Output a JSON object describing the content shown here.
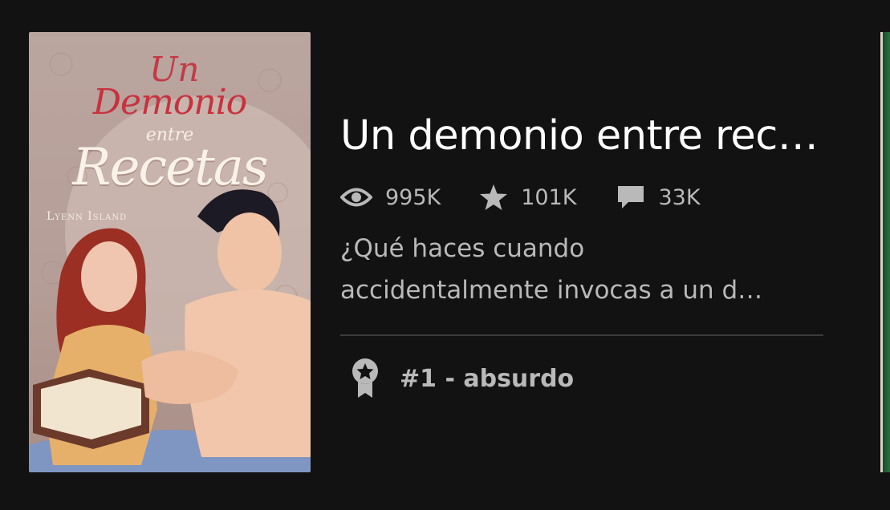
{
  "story": {
    "title": "Un demonio entre rec…",
    "description_line1": "¿Qué haces cuando",
    "description_line2": "accidentalmente invocas a un d…",
    "stats": {
      "reads": "995K",
      "votes": "101K",
      "comments": "33K"
    },
    "ranking": "#1 - absurdo",
    "cover": {
      "title_line1": "Un",
      "title_line2": "Demonio",
      "title_line3": "entre",
      "title_line4": "Recetas",
      "author": "Lyenn Island"
    }
  },
  "icons": {
    "reads": "eye-icon",
    "votes": "star-icon",
    "comments": "comment-icon",
    "ranking": "ribbon-award-icon"
  },
  "colors": {
    "background": "#121212",
    "title": "#ffffff",
    "secondary_text": "#b9b9b9",
    "divider": "#3c3c3c"
  }
}
